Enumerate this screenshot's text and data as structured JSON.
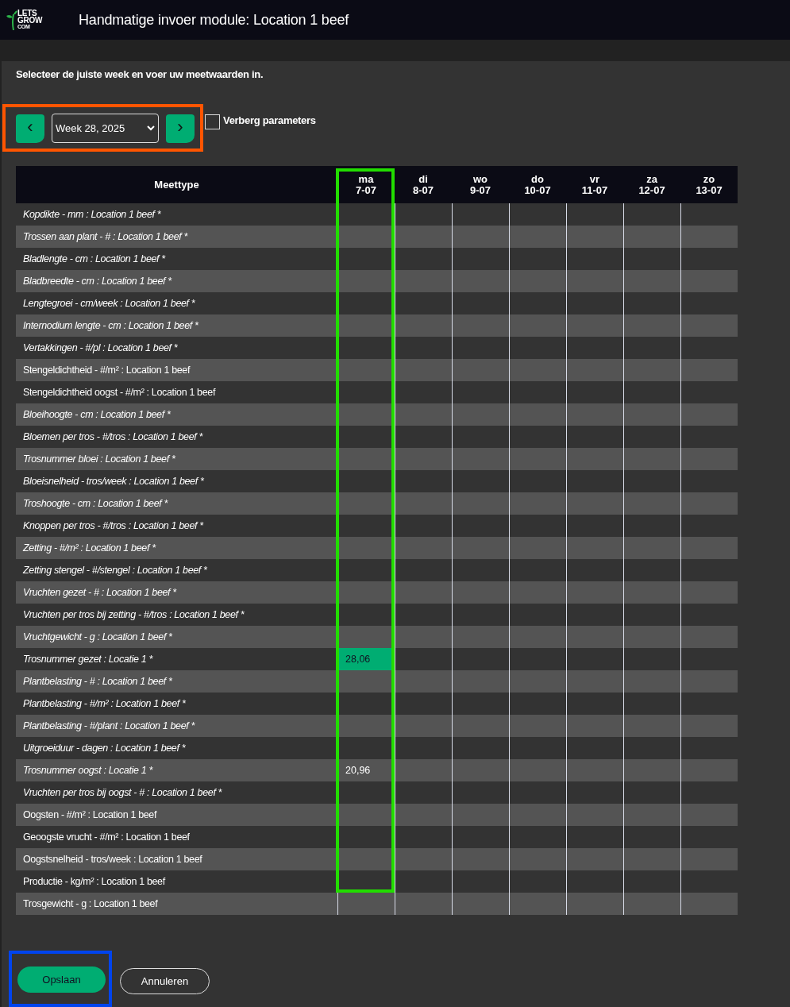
{
  "header": {
    "logo": {
      "top": "LETS",
      "middle": "GROW",
      "bottom": "COM"
    },
    "title": "Handmatige invoer module: Location 1 beef"
  },
  "instruction": "Selecteer de juiste week en voer uw meetwaarden in.",
  "week_nav": {
    "prev": "‹",
    "week": "Week 28, 2025",
    "next": "›"
  },
  "hide_parameters": {
    "label": "Verberg parameters",
    "checked": false
  },
  "table": {
    "label_header": "Meettype",
    "days": [
      {
        "day": "ma",
        "date": "7-07"
      },
      {
        "day": "di",
        "date": "8-07"
      },
      {
        "day": "wo",
        "date": "9-07"
      },
      {
        "day": "do",
        "date": "10-07"
      },
      {
        "day": "vr",
        "date": "11-07"
      },
      {
        "day": "za",
        "date": "12-07"
      },
      {
        "day": "zo",
        "date": "13-07"
      }
    ],
    "rows": [
      {
        "label": "Kopdikte - mm : Location 1 beef *",
        "required": true,
        "selected": false
      },
      {
        "label": "Trossen aan plant - # : Location 1 beef *",
        "required": true,
        "selected": false
      },
      {
        "label": "Bladlengte - cm : Location 1 beef *",
        "required": true,
        "selected": false
      },
      {
        "label": "Bladbreedte - cm : Location 1 beef *",
        "required": true,
        "selected": false
      },
      {
        "label": "Lengtegroei - cm/week : Location 1 beef *",
        "required": true,
        "selected": false
      },
      {
        "label": "Internodium lengte - cm : Location 1 beef *",
        "required": true,
        "selected": false
      },
      {
        "label": "Vertakkingen - #/pl : Location 1 beef *",
        "required": true,
        "selected": false
      },
      {
        "label": "Stengeldichtheid - #/m² : Location 1 beef",
        "required": false,
        "selected": false
      },
      {
        "label": "Stengeldichtheid oogst - #/m² : Location 1 beef",
        "required": false,
        "selected": false
      },
      {
        "label": "Bloeihoogte - cm : Location 1 beef *",
        "required": true,
        "selected": false
      },
      {
        "label": "Bloemen per tros - #/tros : Location 1 beef *",
        "required": true,
        "selected": false
      },
      {
        "label": "Trosnummer bloei : Location 1 beef *",
        "required": true,
        "selected": false
      },
      {
        "label": "Bloeisnelheid - tros/week : Location 1 beef *",
        "required": true,
        "selected": false
      },
      {
        "label": "Troshoogte - cm : Location 1 beef *",
        "required": true,
        "selected": false
      },
      {
        "label": "Knoppen per tros - #/tros : Location 1 beef *",
        "required": true,
        "selected": false
      },
      {
        "label": "Zetting - #/m² : Location 1 beef *",
        "required": true,
        "selected": false
      },
      {
        "label": "Zetting stengel - #/stengel : Location 1 beef *",
        "required": true,
        "selected": false
      },
      {
        "label": "Vruchten gezet - # : Location 1 beef *",
        "required": true,
        "selected": false
      },
      {
        "label": "Vruchten per tros bij zetting - #/tros : Location 1 beef *",
        "required": true,
        "selected": false
      },
      {
        "label": "Vruchtgewicht - g : Location 1 beef *",
        "required": true,
        "selected": false
      },
      {
        "label": "Trosnummer gezet : Locatie 1 *",
        "required": true,
        "value": "28,06",
        "selected": true
      },
      {
        "label": "Plantbelasting - # : Location 1 beef *",
        "required": true,
        "selected": false
      },
      {
        "label": "Plantbelasting - #/m² : Location 1 beef *",
        "required": true,
        "selected": false
      },
      {
        "label": "Plantbelasting - #/plant : Location 1 beef *",
        "required": true,
        "selected": false
      },
      {
        "label": "Uitgroeiduur - dagen : Location 1 beef *",
        "required": true,
        "selected": false
      },
      {
        "label": "Trosnummer oogst : Locatie 1 *",
        "required": true,
        "value": "20,96",
        "selected": false
      },
      {
        "label": "Vruchten per tros bij oogst - # : Location 1 beef *",
        "required": true,
        "selected": false
      },
      {
        "label": "Oogsten - #/m² : Location 1 beef",
        "required": false,
        "selected": false
      },
      {
        "label": "Geoogste vrucht - #/m² : Location 1 beef",
        "required": false,
        "selected": false
      },
      {
        "label": "Oogstsnelheid - tros/week : Location 1 beef",
        "required": false,
        "selected": false
      },
      {
        "label": "Productie - kg/m² : Location 1 beef",
        "required": false,
        "selected": false
      },
      {
        "label": "Trosgewicht - g : Location 1 beef",
        "required": false,
        "selected": false
      }
    ]
  },
  "buttons": {
    "save": "Opslaan",
    "cancel": "Annuleren"
  },
  "highlights": [
    {
      "kind": "week_nav",
      "color": "#ff5500"
    },
    {
      "kind": "first_day_column",
      "color": "#22dd00"
    },
    {
      "kind": "save_button",
      "color": "#0044ee"
    }
  ]
}
